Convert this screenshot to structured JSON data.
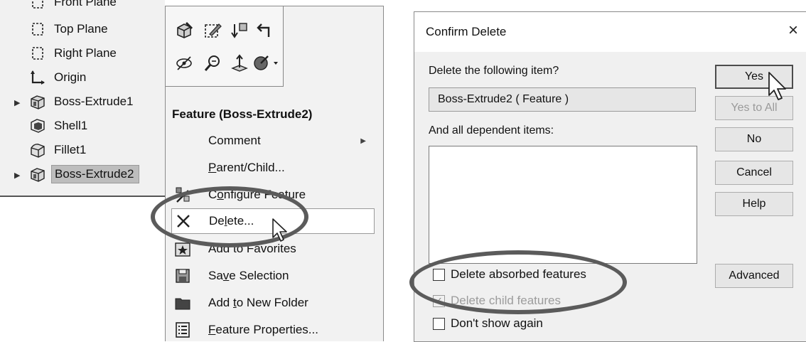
{
  "tree": {
    "items": [
      {
        "label": "Front Plane",
        "icon": "plane-icon"
      },
      {
        "label": "Top Plane",
        "icon": "plane-icon"
      },
      {
        "label": "Right Plane",
        "icon": "plane-icon"
      },
      {
        "label": "Origin",
        "icon": "origin-icon"
      },
      {
        "label": "Boss-Extrude1",
        "icon": "extrude-icon"
      },
      {
        "label": "Shell1",
        "icon": "shell-icon"
      },
      {
        "label": "Fillet1",
        "icon": "fillet-icon"
      },
      {
        "label": "Boss-Extrude2",
        "icon": "extrude-icon"
      }
    ]
  },
  "context_menu": {
    "header": "Feature (Boss-Extrude2)",
    "toolbar_icons": [
      "edit-feature-icon",
      "edit-sketch-icon",
      "rollback-icon",
      "undo-icon",
      "hide-icon",
      "zoom-to-selection-icon",
      "normal-to-icon",
      "appearance-icon"
    ],
    "items": [
      {
        "pre": "",
        "u": "",
        "post": "Comment",
        "icon": "",
        "submenu": true
      },
      {
        "pre": "",
        "u": "P",
        "post": "arent/Child...",
        "icon": ""
      },
      {
        "pre": "C",
        "u": "o",
        "post": "nfigure Feature",
        "icon": "configure-feature-icon"
      },
      {
        "pre": "De",
        "u": "l",
        "post": "ete...",
        "icon": "delete-x-icon"
      },
      {
        "pre": "",
        "u": "",
        "post": "Add to Favorites",
        "icon": "favorites-icon"
      },
      {
        "pre": "Sa",
        "u": "v",
        "post": "e Selection",
        "icon": "save-selection-icon"
      },
      {
        "pre": "Add ",
        "u": "t",
        "post": "o New Folder",
        "icon": "folder-icon"
      },
      {
        "pre": "",
        "u": "F",
        "post": "eature Properties...",
        "icon": "properties-icon"
      }
    ]
  },
  "dialog": {
    "title": "Confirm Delete",
    "close_glyph": "×",
    "delete_prompt": "Delete the following item?",
    "item_value": "Boss-Extrude2 ( Feature )",
    "dependent_label": "And all dependent items:",
    "buttons": {
      "yes": "Yes",
      "yes_to_all": "Yes to All",
      "no": "No",
      "cancel": "Cancel",
      "help": "Help",
      "advanced": "Advanced"
    },
    "checkboxes": {
      "absorbed": "Delete absorbed features",
      "child": "Delete child features",
      "dont_show": "Don't show again"
    }
  }
}
